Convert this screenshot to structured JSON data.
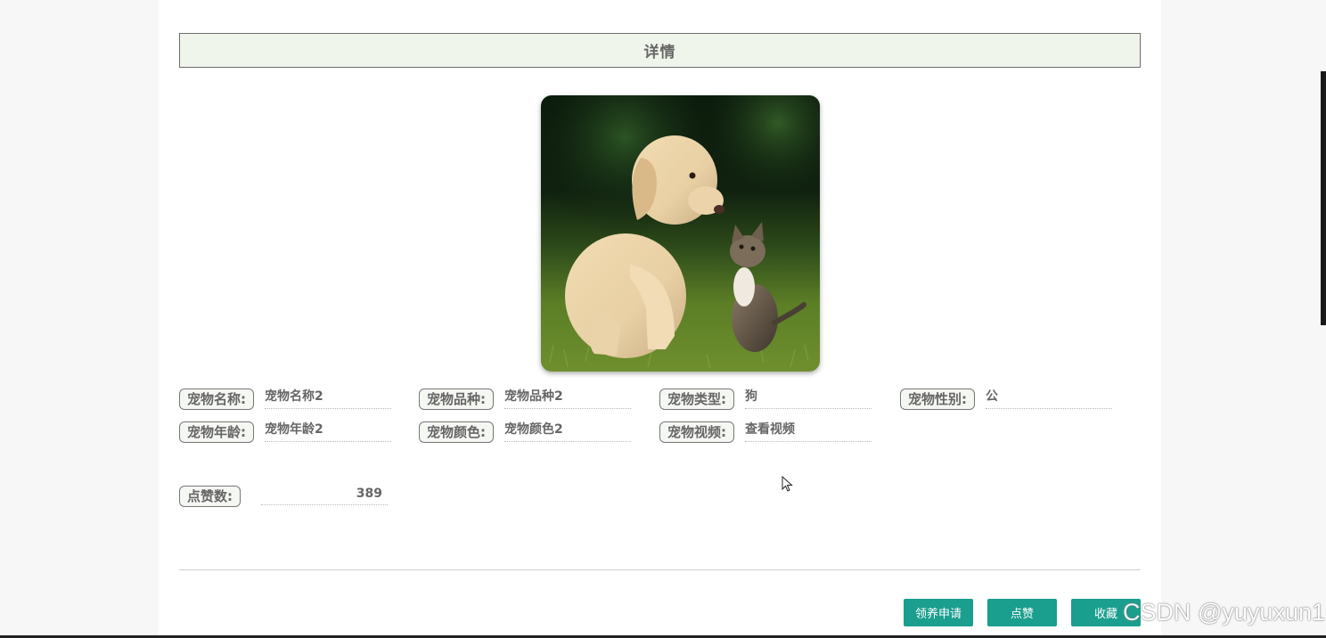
{
  "header": {
    "title": "详情"
  },
  "photo": {
    "subject": "puppy-and-kitten-photo"
  },
  "fields": [
    {
      "label": "宠物名称:",
      "value": "宠物名称2"
    },
    {
      "label": "宠物品种:",
      "value": "宠物品种2"
    },
    {
      "label": "宠物类型:",
      "value": "狗"
    },
    {
      "label": "宠物性别:",
      "value": "公"
    },
    {
      "label": "宠物年龄:",
      "value": "宠物年龄2"
    },
    {
      "label": "宠物颜色:",
      "value": "宠物颜色2"
    },
    {
      "label": "宠物视频:",
      "value": "查看视频"
    }
  ],
  "likes": {
    "label": "点赞数:",
    "value": "389"
  },
  "actions": {
    "adopt_label": "领养申请",
    "like_label": "点赞",
    "favorite_label": "收藏"
  },
  "watermark": "CSDN @yuyuxun1",
  "colors": {
    "accent": "#1a9e8e",
    "title_bg": "#f0f5ec"
  }
}
